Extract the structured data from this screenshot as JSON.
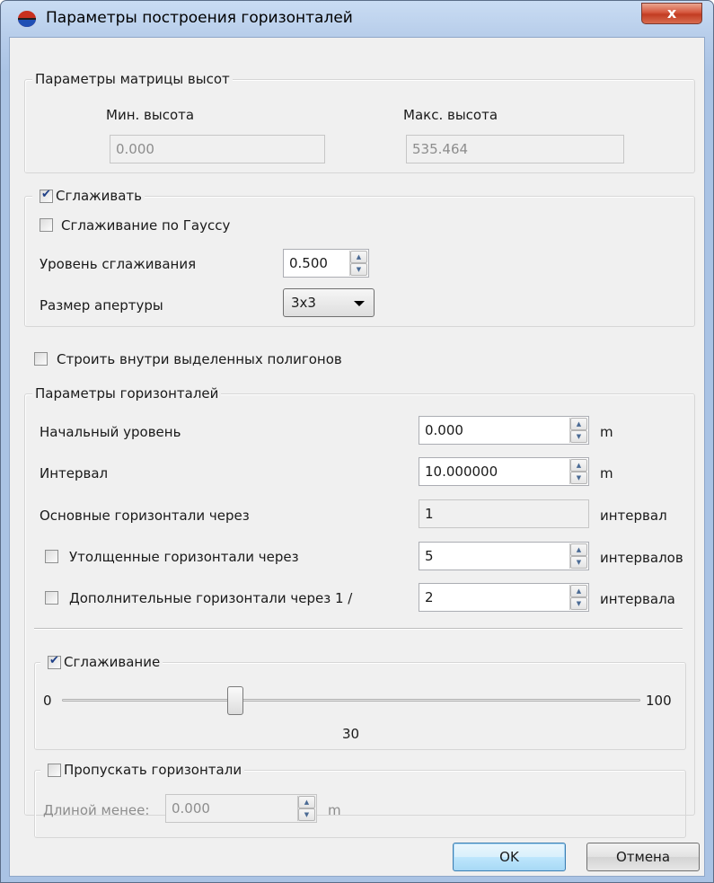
{
  "window": {
    "title": "Параметры построения горизонталей",
    "close_label": "x"
  },
  "height_matrix": {
    "legend": "Параметры матрицы высот",
    "min_label": "Мин. высота",
    "min_value": "0.000",
    "max_label": "Макс. высота",
    "max_value": "535.464"
  },
  "smoothing": {
    "legend": "Сглаживать",
    "enabled": true,
    "gauss_label": "Сглаживание по Гауссу",
    "gauss_checked": false,
    "level_label": "Уровень сглаживания",
    "level_value": "0.500",
    "aperture_label": "Размер апертуры",
    "aperture_value": "3x3"
  },
  "inside_polygons": {
    "label": "Строить внутри выделенных полигонов",
    "checked": false
  },
  "contour_params": {
    "legend": "Параметры горизонталей",
    "start_label": "Начальный уровень",
    "start_value": "0.000",
    "start_unit": "m",
    "interval_label": "Интервал",
    "interval_value": "10.000000",
    "interval_unit": "m",
    "main_label": "Основные горизонтали через",
    "main_value": "1",
    "main_unit": "интервал",
    "thick_label": "Утолщенные горизонтали через",
    "thick_value": "5",
    "thick_unit": "интервалов",
    "thick_checked": false,
    "extra_label": "Дополнительные горизонтали через 1 /",
    "extra_value": "2",
    "extra_unit": "интервала",
    "extra_checked": false
  },
  "slider_smoothing": {
    "legend": "Сглаживание",
    "enabled": true,
    "min_label": "0",
    "max_label": "100",
    "value_label": "30",
    "value": 30,
    "min": 0,
    "max": 100
  },
  "skip_contours": {
    "legend": "Пропускать горизонтали",
    "checked": false,
    "length_label": "Длиной менее:",
    "length_value": "0.000",
    "length_unit": "m"
  },
  "buttons": {
    "ok": "OK",
    "cancel": "Отмена"
  },
  "colors": {
    "title_gradient_top": "#c9dcf3",
    "close_button": "#c23c22",
    "dialog_bg": "#f0f0f0",
    "check_mark": "#1e3f87"
  },
  "icons": {
    "title": "app-globe-icon",
    "spin": "spin-up-down-icon",
    "dropdown": "chevron-down-icon"
  }
}
